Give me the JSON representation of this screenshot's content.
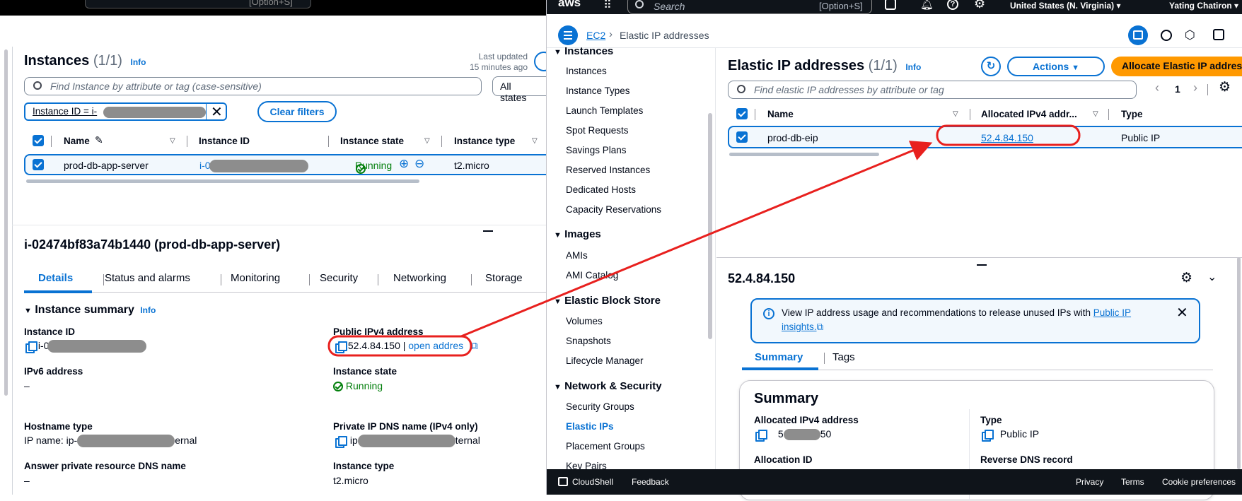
{
  "left": {
    "topbar": {
      "shortcut": "[Option+S]"
    },
    "instances": {
      "title": "Instances",
      "count": "(1/1)",
      "info": "Info",
      "last_updated": "Last updated",
      "last_updated_ago": "15 minutes ago",
      "search_placeholder": "Find Instance by attribute or tag (case-sensitive)",
      "states_dropdown": "All states",
      "filter_chip": "Instance ID = i-",
      "clear_filters": "Clear filters",
      "columns": [
        "Name",
        "Instance ID",
        "Instance state",
        "Instance type"
      ],
      "row": {
        "name": "prod-db-app-server",
        "instance_id_prefix": "i-0",
        "state": "Running",
        "type": "t2.micro"
      }
    },
    "detail": {
      "title": "i-02474bf83a74b1440 (prod-db-app-server)",
      "tabs": [
        "Details",
        "Status and alarms",
        "Monitoring",
        "Security",
        "Networking",
        "Storage"
      ],
      "summary_title": "Instance summary",
      "info": "Info",
      "instance_id_label": "Instance ID",
      "instance_id_prefix": "i-0",
      "public_ipv4_label": "Public IPv4 address",
      "public_ipv4_value": "52.4.84.150 |",
      "open_address": "open addres",
      "ipv6_label": "IPv6 address",
      "ipv6_value": "–",
      "instance_state_label": "Instance state",
      "instance_state_value": "Running",
      "hostname_label": "Hostname type",
      "hostname_prefix": "IP name: ip-",
      "hostname_suffix": "ernal",
      "private_dns_label": "Private IP DNS name (IPv4 only)",
      "private_dns_prefix": "ip",
      "private_dns_suffix": "ternal",
      "answer_dns_label": "Answer private resource DNS name",
      "answer_dns_value": "–",
      "instance_type_label": "Instance type",
      "instance_type_value": "t2.micro"
    }
  },
  "right": {
    "topbar": {
      "search_placeholder": "Search",
      "shortcut": "[Option+S]",
      "region": "United States (N. Virginia)",
      "user": "Yating Chatiron"
    },
    "breadcrumb": {
      "root": "EC2",
      "current": "Elastic IP addresses"
    },
    "nav": {
      "instances_section": "Instances",
      "instances_items": [
        "Instances",
        "Instance Types",
        "Launch Templates",
        "Spot Requests",
        "Savings Plans",
        "Reserved Instances",
        "Dedicated Hosts",
        "Capacity Reservations"
      ],
      "images_section": "Images",
      "images_items": [
        "AMIs",
        "AMI Catalog"
      ],
      "ebs_section": "Elastic Block Store",
      "ebs_items": [
        "Volumes",
        "Snapshots",
        "Lifecycle Manager"
      ],
      "netsec_section": "Network & Security",
      "netsec_items": [
        "Security Groups",
        "Elastic IPs",
        "Placement Groups",
        "Key Pairs"
      ]
    },
    "eip": {
      "title": "Elastic IP addresses",
      "count": "(1/1)",
      "info": "Info",
      "actions": "Actions",
      "allocate": "Allocate Elastic IP address",
      "search_placeholder": "Find elastic IP addresses by attribute or tag",
      "page": "1",
      "columns": [
        "Name",
        "Allocated IPv4 addr...",
        "Type"
      ],
      "row": {
        "name": "prod-db-eip",
        "ip": "52.4.84.150",
        "type": "Public IP"
      }
    },
    "detail": {
      "title": "52.4.84.150",
      "notice_text": "View IP address usage and recommendations to release unused IPs with ",
      "notice_link": "Public IP insights.",
      "tabs": [
        "Summary",
        "Tags"
      ],
      "summary_heading": "Summary",
      "allocated_label": "Allocated IPv4 address",
      "allocated_prefix": "5",
      "allocated_suffix": "50",
      "type_label": "Type",
      "type_value": "Public IP",
      "allocation_id_label": "Allocation ID",
      "reverse_dns_label": "Reverse DNS record"
    },
    "footer": {
      "cloudshell": "CloudShell",
      "feedback": "Feedback",
      "privacy": "Privacy",
      "terms": "Terms",
      "cookies": "Cookie preferences"
    }
  },
  "colors": {
    "aws_dark": "#232f3e",
    "primary": "#0972d3",
    "orange": "#ff9900",
    "success": "#037f0c",
    "annotation": "#e8201e"
  }
}
